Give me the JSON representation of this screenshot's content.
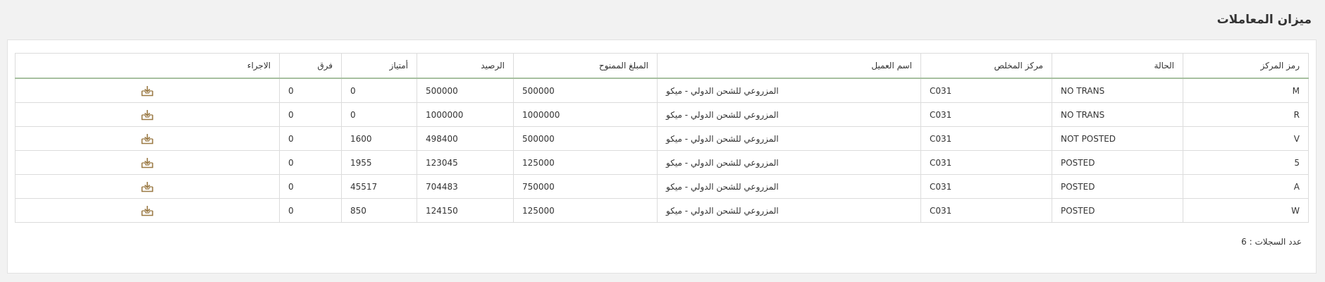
{
  "page": {
    "title": "ميزان المعاملات"
  },
  "table": {
    "headers": [
      "رمز المركز",
      "الحالة",
      "مركز المخلص",
      "اسم العميل",
      "المبلغ الممنوح",
      "الرصيد",
      "أمتياز",
      "فرق",
      "الاجراء"
    ],
    "rows": [
      {
        "center_code": "M",
        "status": "NO TRANS",
        "broker_center": "C031",
        "client_name": "المزروعي للشحن الدولي - ميكو",
        "granted_amount": "500000",
        "balance": "500000",
        "privilege": "0",
        "difference": "0",
        "action_icon": "download-icon"
      },
      {
        "center_code": "R",
        "status": "NO TRANS",
        "broker_center": "C031",
        "client_name": "المزروعي للشحن الدولي - ميكو",
        "granted_amount": "1000000",
        "balance": "1000000",
        "privilege": "0",
        "difference": "0",
        "action_icon": "download-icon"
      },
      {
        "center_code": "V",
        "status": "NOT POSTED",
        "broker_center": "C031",
        "client_name": "المزروعي للشحن الدولي - ميكو",
        "granted_amount": "500000",
        "balance": "498400",
        "privilege": "1600",
        "difference": "0",
        "action_icon": "download-icon"
      },
      {
        "center_code": "5",
        "status": "POSTED",
        "broker_center": "C031",
        "client_name": "المزروعي للشحن الدولي - ميكو",
        "granted_amount": "125000",
        "balance": "123045",
        "privilege": "1955",
        "difference": "0",
        "action_icon": "download-icon"
      },
      {
        "center_code": "A",
        "status": "POSTED",
        "broker_center": "C031",
        "client_name": "المزروعي للشحن الدولي - ميكو",
        "granted_amount": "750000",
        "balance": "704483",
        "privilege": "45517",
        "difference": "0",
        "action_icon": "download-icon"
      },
      {
        "center_code": "W",
        "status": "POSTED",
        "broker_center": "C031",
        "client_name": "المزروعي للشحن الدولي - ميكو",
        "granted_amount": "125000",
        "balance": "124150",
        "privilege": "850",
        "difference": "0",
        "action_icon": "download-icon"
      }
    ]
  },
  "footer": {
    "records_label": "عدد السجلات : 6"
  },
  "colors": {
    "header_underline": "#a7c0a0",
    "icon": "#9b7a45"
  }
}
